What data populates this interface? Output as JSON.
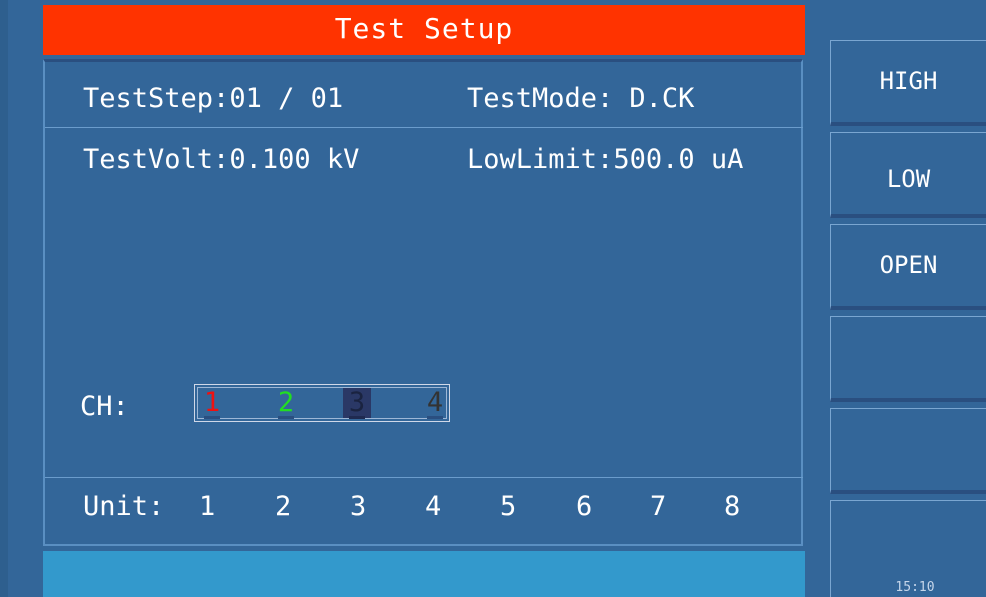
{
  "title": "Test Setup",
  "fields": {
    "test_step_label": "TestStep:",
    "test_step_value": "01 / 01",
    "test_mode_label": "TestMode:",
    "test_mode_value": "D.CK",
    "test_volt_label": "TestVolt:",
    "test_volt_value": "0.100 kV",
    "low_limit_label": "LowLimit:",
    "low_limit_value": "500.0 uA"
  },
  "channels": {
    "label": "CH:",
    "items": [
      {
        "label": "1",
        "color": "#ee1111"
      },
      {
        "label": "2",
        "color": "#22dd22"
      },
      {
        "label": "3",
        "color": "#1a2340",
        "selected": true
      },
      {
        "label": "4",
        "color": "#333333"
      }
    ]
  },
  "units": {
    "label": "Unit:",
    "items": [
      "1",
      "2",
      "3",
      "4",
      "5",
      "6",
      "7",
      "8"
    ]
  },
  "softkeys": [
    {
      "label": "HIGH"
    },
    {
      "label": "LOW"
    },
    {
      "label": "OPEN"
    },
    {
      "label": ""
    },
    {
      "label": ""
    },
    {
      "label": ""
    }
  ],
  "clock": "15:10",
  "colors": {
    "background": "#336699",
    "title_bar": "#ff3300",
    "status_bar": "#3399cc"
  }
}
